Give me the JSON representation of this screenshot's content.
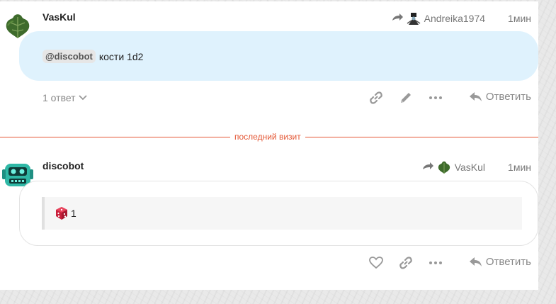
{
  "posts": [
    {
      "username": "VasKul",
      "reply_to": "Andreika1974",
      "time": "1мин",
      "mention": "@discobot",
      "text": "кости 1d2",
      "replies_label": "1 ответ",
      "reply_label": "Ответить"
    },
    {
      "username": "discobot",
      "reply_to": "VasKul",
      "time": "1мин",
      "dice_result": "1",
      "reply_label": "Ответить"
    }
  ],
  "divider": {
    "label": "последний визит"
  },
  "colors": {
    "bubble_bg": "#dff2fd",
    "divider": "#e45735",
    "muted_icon": "#999999"
  },
  "icons": [
    "fig-leaf-avatar",
    "robot-avatar",
    "reply-arrow-icon",
    "link-icon",
    "pencil-icon",
    "more-icon",
    "heart-icon",
    "dice-icon",
    "chevron-down-icon"
  ]
}
